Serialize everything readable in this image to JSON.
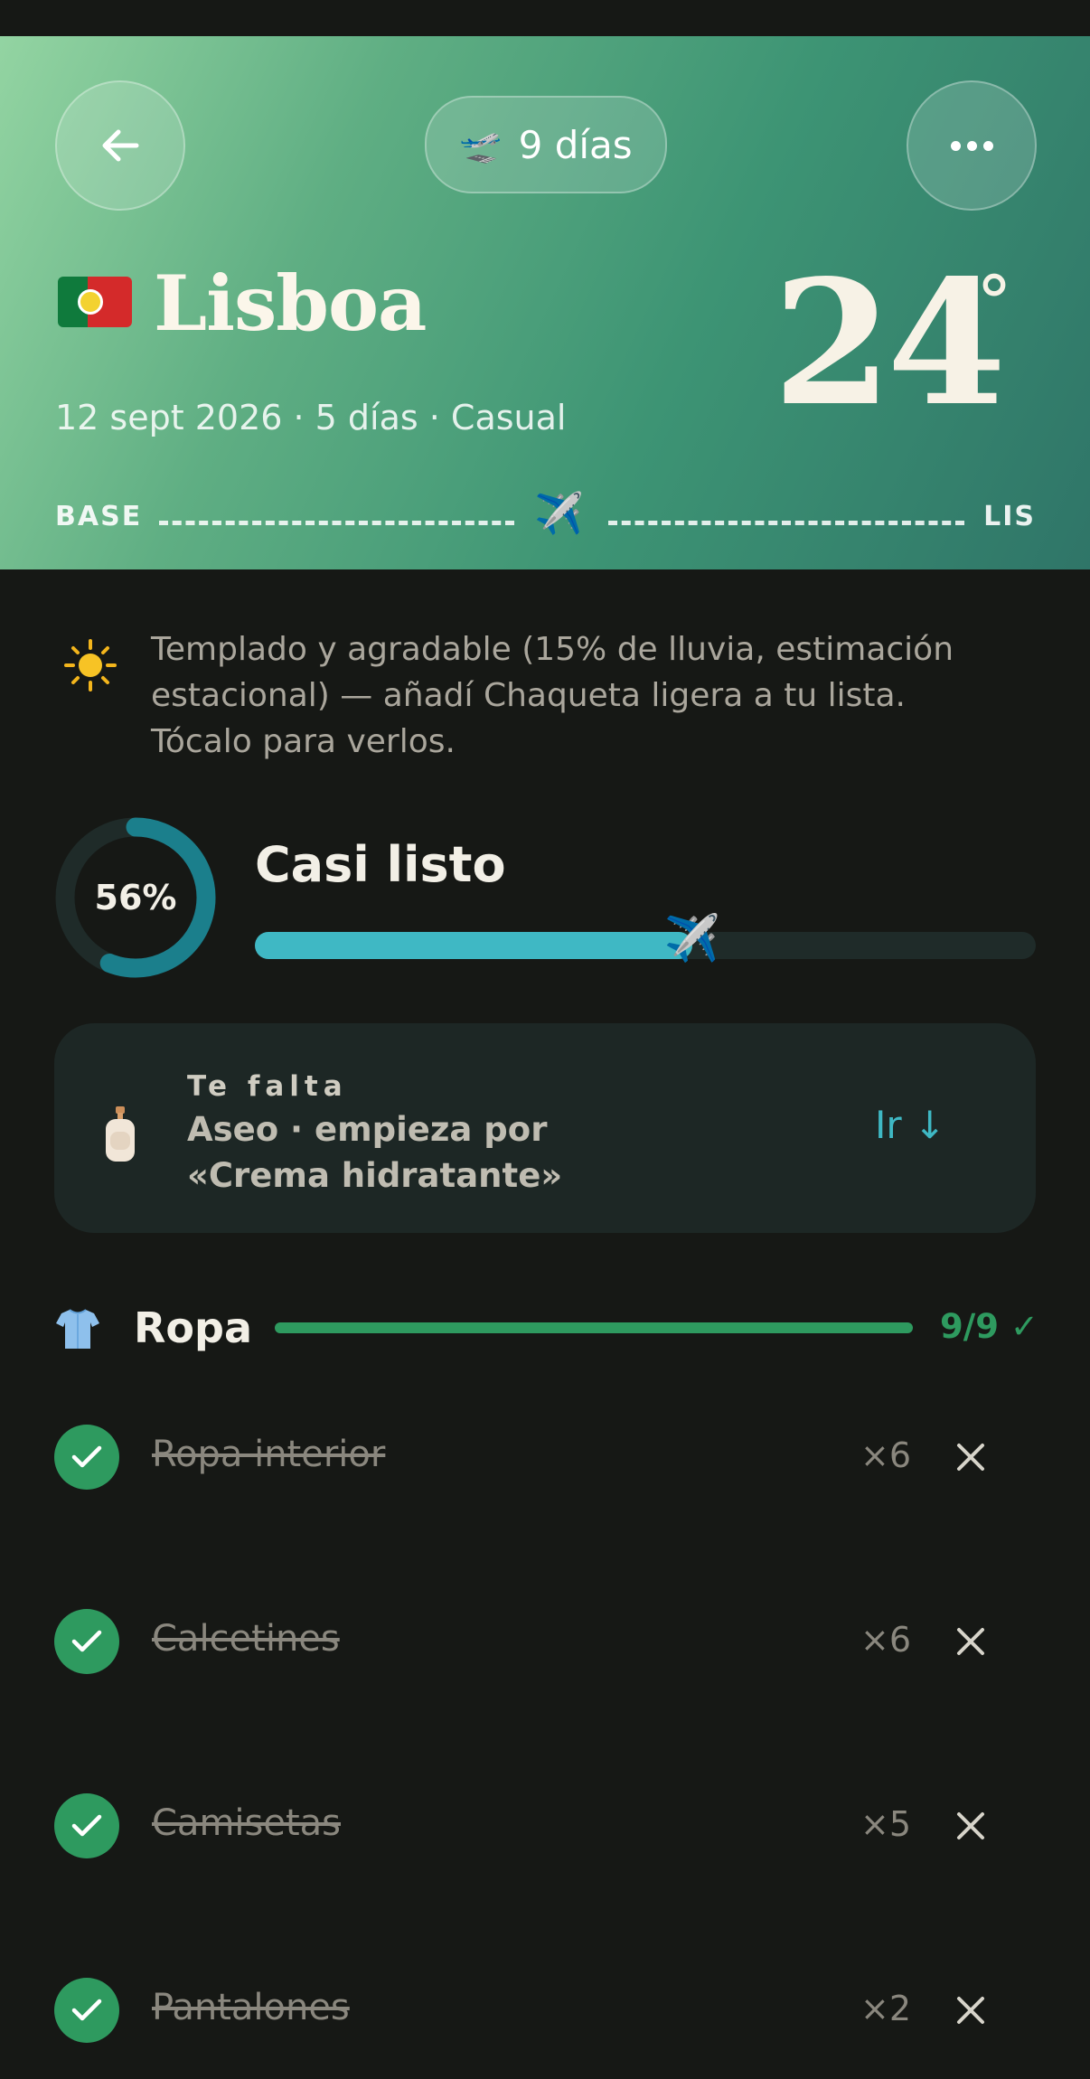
{
  "header": {
    "duration_label": "9 días",
    "city": "Lisboa",
    "trip_meta": "12 sept 2026 · 5 días · Casual",
    "temperature": "24",
    "temperature_unit": "°",
    "route_from": "BASE",
    "route_to": "LIS",
    "icons": {
      "back": "arrow-left-icon",
      "more": "ellipsis-icon",
      "duration": "airplane-departure-icon",
      "flag": "portugal-flag-icon",
      "route": "airplane-icon"
    }
  },
  "weather_note": {
    "icon": "sun-icon",
    "text": "Templado y agradable (15% de lluvia, estimación estacional) — añadí Chaqueta ligera a tu lista. Tócalo para verlos."
  },
  "progress": {
    "percent_label": "56%",
    "fraction": 0.56,
    "title": "Casi listo"
  },
  "next_item_card": {
    "icon": "lotion-bottle-icon",
    "kicker": "Te falta",
    "text": "Aseo · empieza por «Crema hidratante»",
    "go_label": "Ir ↓"
  },
  "category": {
    "icon": "shirt-icon",
    "title": "Ropa",
    "count_label": "9/9 ✓",
    "fraction": 1.0,
    "items": [
      {
        "name": "Ropa interior",
        "qty": "×6"
      },
      {
        "name": "Calcetines",
        "qty": "×6"
      },
      {
        "name": "Camisetas",
        "qty": "×5"
      },
      {
        "name": "Pantalones",
        "qty": "×2"
      }
    ]
  },
  "colors": {
    "accent_teal": "#3fb8c4",
    "accent_green": "#2e9a5f",
    "background": "#161815",
    "card": "#1d2725"
  }
}
